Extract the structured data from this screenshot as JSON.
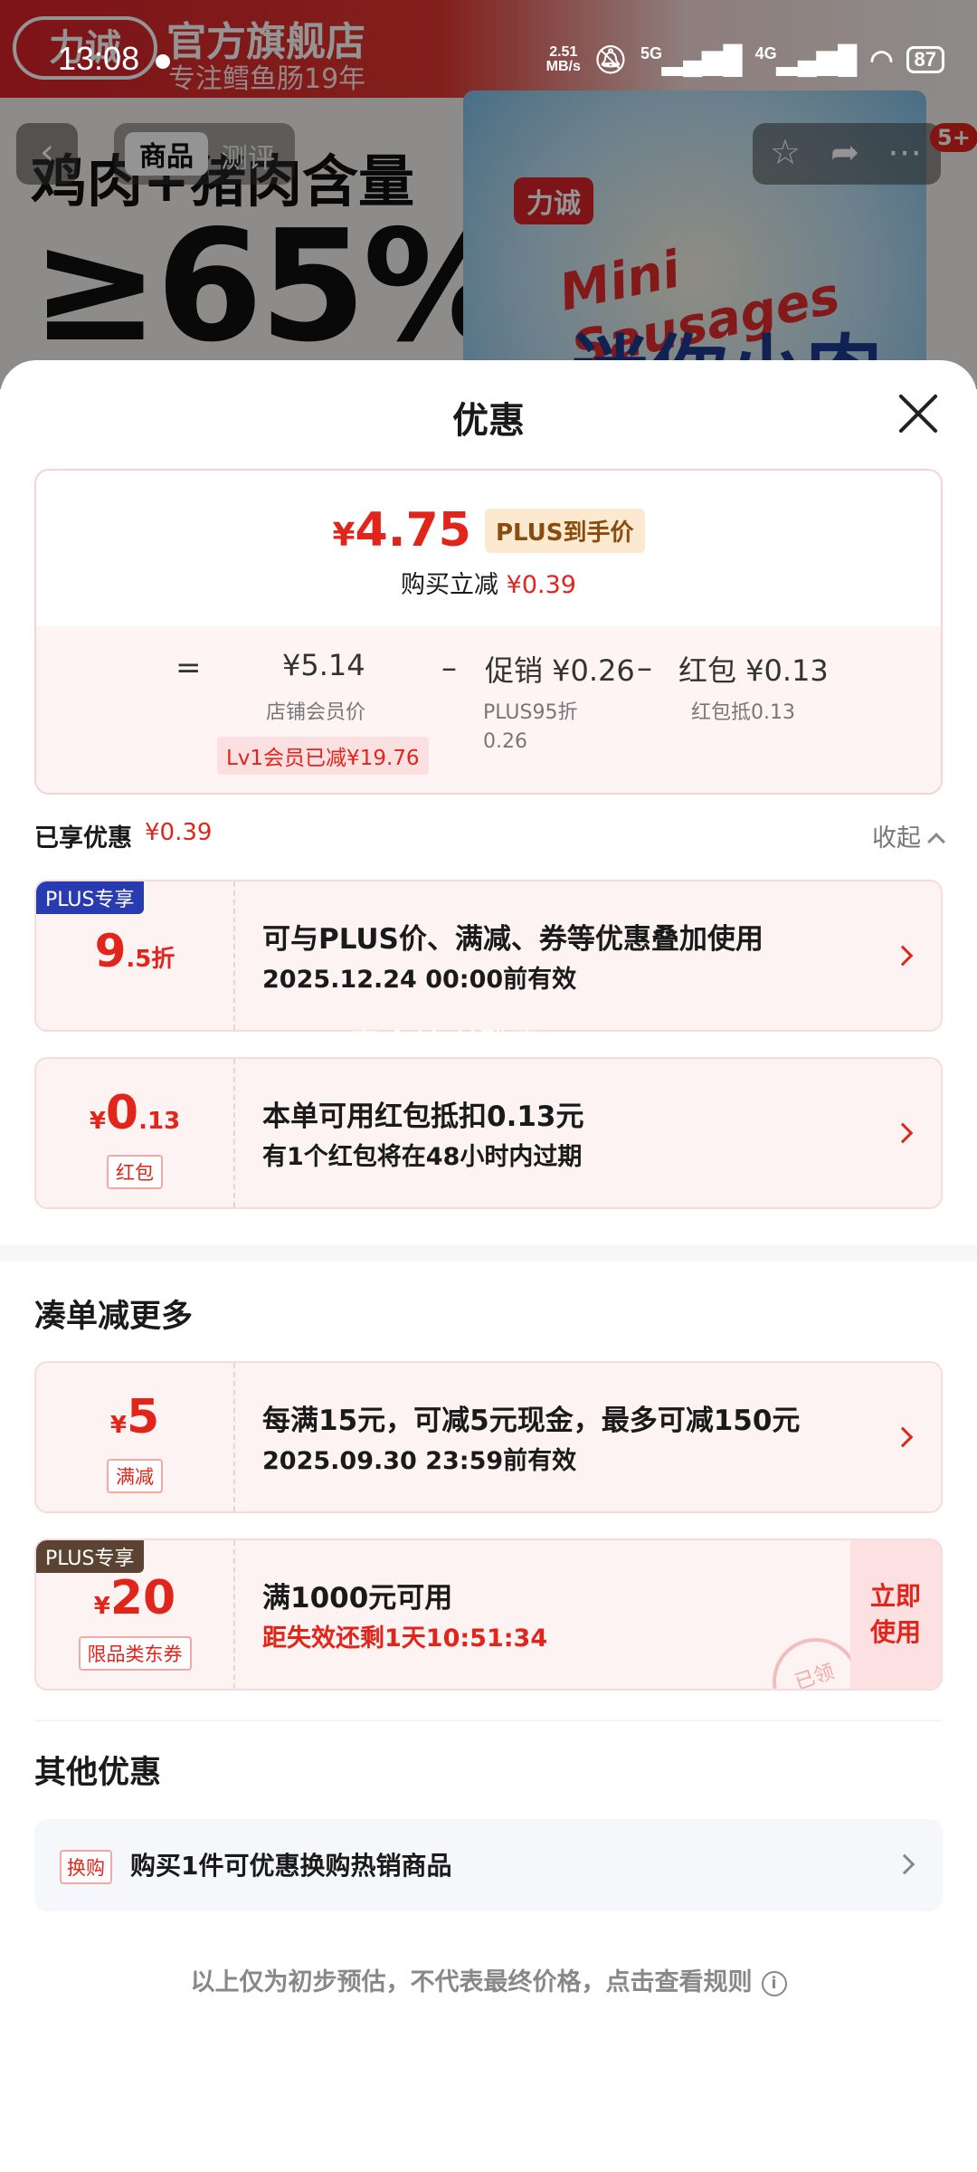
{
  "status_bar": {
    "time": "13:08",
    "net_speed_value": "2.51",
    "net_speed_unit": "MB/s",
    "signal_5g": "5G",
    "signal_4g": "4G",
    "battery": "87"
  },
  "background_page": {
    "store_logo": "力诚",
    "store_name": "官方旗舰店",
    "store_subtitle": "专注鳕鱼肠19年",
    "hero_text_line1": "鸡肉+猪肉含量",
    "hero_text_line2": "≥65%",
    "product_brand": "力诚",
    "product_en": "Mini Sausages",
    "product_cn": "迷你小肉枣",
    "tabs": [
      "商品",
      "测评"
    ],
    "notification_badge": "5+"
  },
  "sheet": {
    "title": "优惠",
    "price_summary": {
      "final_price": "4.75",
      "currency": "¥",
      "plus_tag": "PLUS到手价",
      "instant_reduction_label": "购买立减",
      "instant_reduction_value": "¥0.39",
      "equals": "=",
      "items": [
        {
          "value": "¥5.14",
          "label": "店铺会员价"
        },
        {
          "op": "–",
          "value": "促销 ¥0.26",
          "label_line1": "PLUS95折",
          "label_line2": "0.26"
        },
        {
          "op": "–",
          "value": "红包 ¥0.13",
          "label": "红包抵0.13"
        }
      ],
      "member_tag": "Lv1会员已减¥19.76"
    },
    "enjoyed": {
      "label": "已享优惠",
      "amount": "¥0.39",
      "collapse_label": "收起"
    },
    "coupons_enjoyed": [
      {
        "corner": "PLUS专享",
        "big_main": "9",
        "big_small": ".5折",
        "title": "可与PLUS价、满减、券等优惠叠加使用",
        "subtitle": "2025.12.24 00:00前有效"
      },
      {
        "big_prefix": "¥",
        "big_main": "0",
        "big_small": ".13",
        "tag": "红包",
        "title": "本单可用红包抵扣0.13元",
        "subtitle": "有1个红包将在48小时内过期"
      }
    ],
    "more_section_title": "凑单减更多",
    "coupons_more": [
      {
        "big_prefix": "¥",
        "big_main": "5",
        "tag": "满减",
        "title": "每满15元，可减5元现金，最多可减150元",
        "subtitle": "2025.09.30 23:59前有效"
      },
      {
        "corner": "PLUS专享",
        "big_prefix": "¥",
        "big_main": "20",
        "tag": "限品类东券",
        "title": "满1000元可用",
        "subtitle": "距失效还剩1天10:51:34",
        "action_line1": "立即",
        "action_line2": "使用",
        "stamp": "已领"
      }
    ],
    "other_section_title": "其他优惠",
    "other_item": {
      "tag": "换购",
      "text": "购买1件可优惠换购热销商品"
    },
    "disclaimer": "以上仅为初步预估，不代表最终价格，点击查看规则",
    "watermark": "宿命论者雅克"
  },
  "colors": {
    "accent_red": "#e1251b",
    "plus_blue": "#283bb0",
    "plus_brown": "#5a4333",
    "card_bg": "#fdf3f3"
  }
}
